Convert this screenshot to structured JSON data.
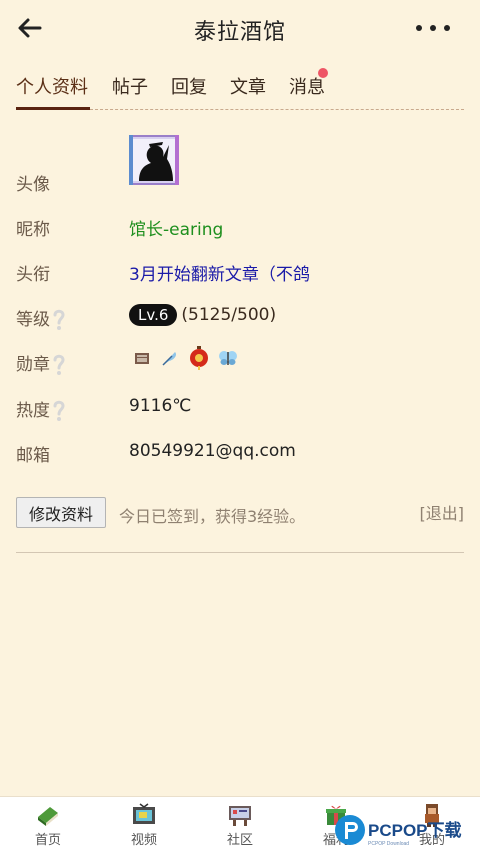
{
  "header": {
    "title": "泰拉酒馆"
  },
  "tabs": [
    {
      "label": "个人资料"
    },
    {
      "label": "帖子"
    },
    {
      "label": "回复"
    },
    {
      "label": "文章"
    },
    {
      "label": "消息"
    }
  ],
  "profile": {
    "avatar_label": "头像",
    "nickname_label": "昵称",
    "nickname": "馆长-earing",
    "title_label": "头衔",
    "title_value": "3月开始翻新文章（不鸽",
    "level_label": "等级",
    "level_badge": "Lv.6",
    "level_progress": "(5125/500)",
    "medal_label": "勋章",
    "heat_label": "热度",
    "heat_value": "9116℃",
    "email_label": "邮箱",
    "email_value": "80549921@qq.com"
  },
  "actions": {
    "edit_label": "修改资料",
    "checkin_text": "今日已签到，获得3经验。",
    "logout_label": "[退出]"
  },
  "bottom_nav": [
    {
      "label": "首页"
    },
    {
      "label": "视频"
    },
    {
      "label": "社区"
    },
    {
      "label": "福利"
    },
    {
      "label": "我的"
    }
  ],
  "watermark": {
    "text": "PCPOP下载"
  },
  "colors": {
    "background": "#fcf3de",
    "nickname": "#1e8f1e",
    "title_value": "#1a1aa8",
    "notif_dot": "#ee5565",
    "tab_underline": "#5a2310"
  }
}
